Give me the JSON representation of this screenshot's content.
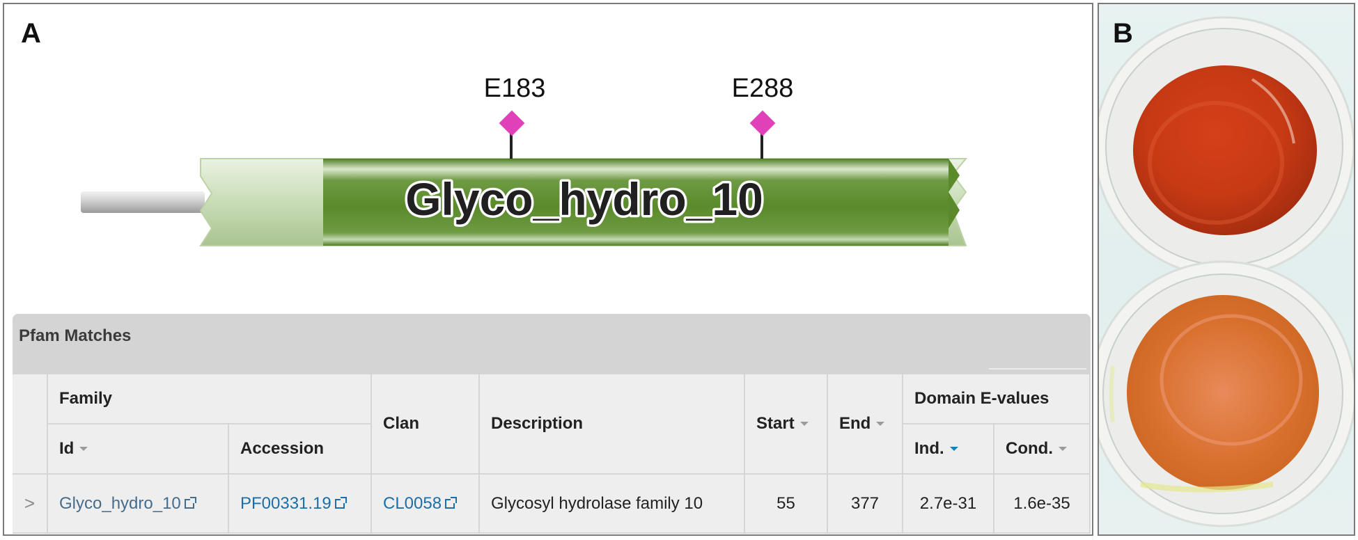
{
  "panels": {
    "a_letter": "A",
    "b_letter": "B"
  },
  "domain_graphic": {
    "domain_name": "Glyco_hydro_10",
    "active_sites": [
      "E183",
      "E288"
    ],
    "domain_color": "#5a8a2a",
    "site_marker_color": "#e040b8"
  },
  "pfam_table": {
    "title": "Pfam Matches",
    "headers": {
      "family": "Family",
      "id": "Id",
      "accession": "Accession",
      "clan": "Clan",
      "description": "Description",
      "start": "Start",
      "end": "End",
      "domain_evalues": "Domain E-values",
      "ind": "Ind.",
      "cond": "Cond."
    },
    "rows": [
      {
        "toggle": ">",
        "id": "Glyco_hydro_10",
        "accession": "PF00331.19",
        "clan": "CL0058",
        "description": "Glycosyl hydrolase family 10",
        "start": "55",
        "end": "377",
        "ind": "2.7e-31",
        "cond": "1.6e-35"
      }
    ]
  },
  "photo": {
    "top_well_color": "#c83a14",
    "bottom_well_color": "#d9702e"
  }
}
